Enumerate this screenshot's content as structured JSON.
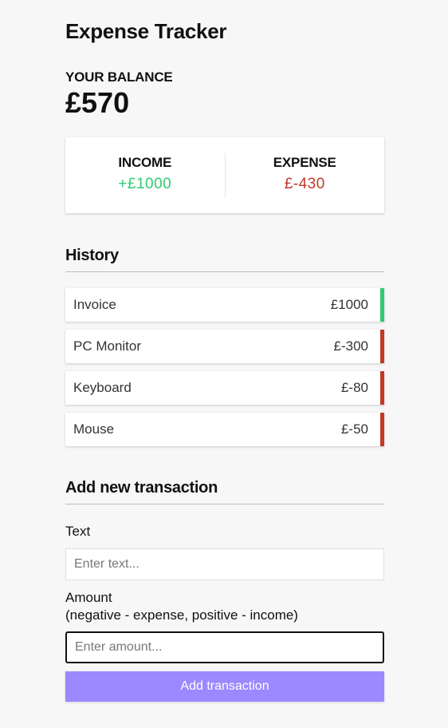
{
  "app": {
    "title": "Expense Tracker"
  },
  "balance": {
    "label": "YOUR BALANCE",
    "value": "£570"
  },
  "summary": {
    "income_label": "INCOME",
    "income_value": "+£1000",
    "expense_label": "EXPENSE",
    "expense_value": "£-430"
  },
  "history": {
    "title": "History",
    "items": [
      {
        "text": "Invoice",
        "amount": "£1000",
        "type": "plus"
      },
      {
        "text": "PC Monitor",
        "amount": "£-300",
        "type": "minus"
      },
      {
        "text": "Keyboard",
        "amount": "£-80",
        "type": "minus"
      },
      {
        "text": "Mouse",
        "amount": "£-50",
        "type": "minus"
      }
    ]
  },
  "form": {
    "title": "Add new transaction",
    "text_label": "Text",
    "text_placeholder": "Enter text...",
    "amount_label": "Amount",
    "amount_hint": "(negative - expense, positive - income)",
    "amount_placeholder": "Enter amount...",
    "submit_label": "Add transaction"
  },
  "colors": {
    "income": "#2ecc71",
    "expense": "#c0392b",
    "button": "#9c88ff"
  }
}
